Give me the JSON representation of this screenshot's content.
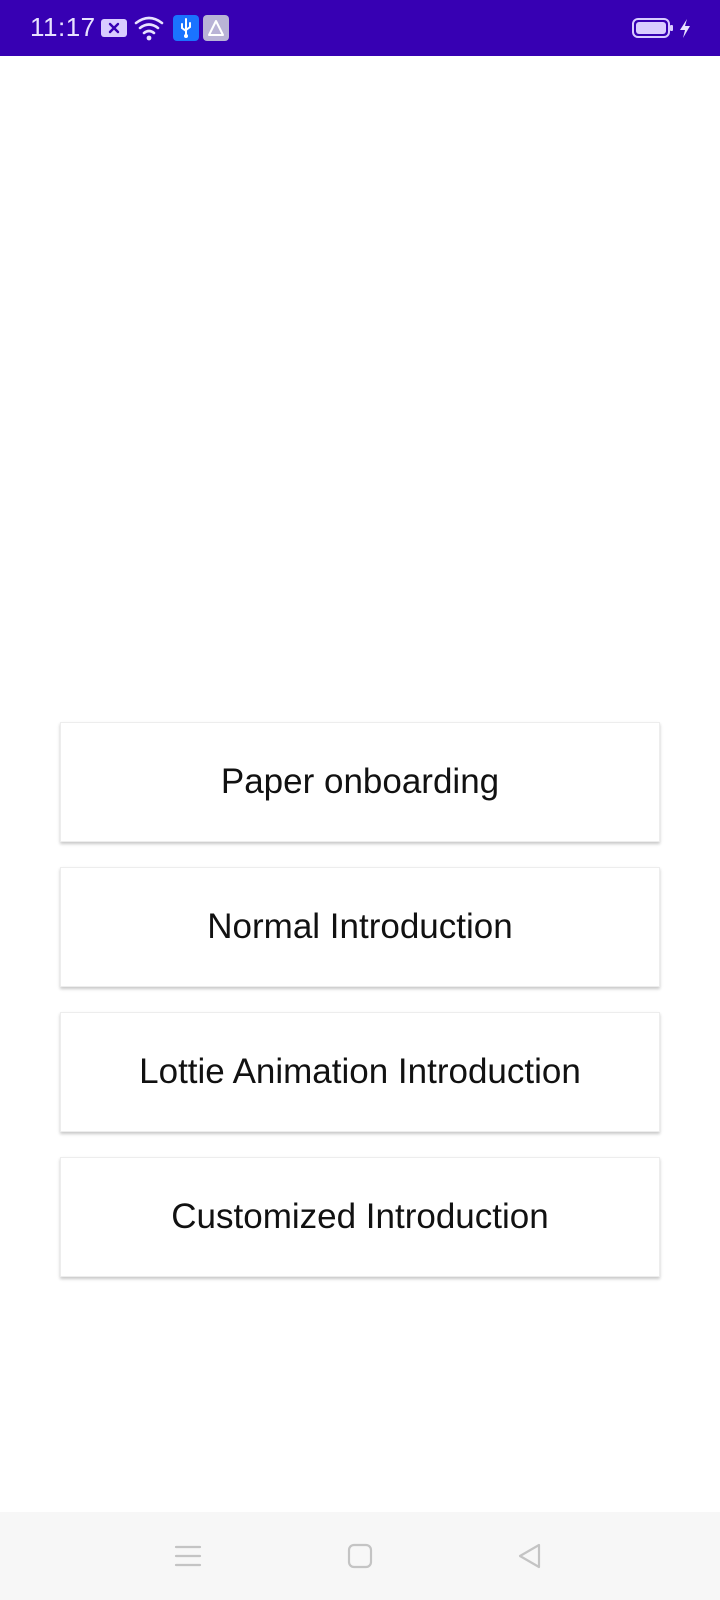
{
  "status_bar": {
    "time": "11:17",
    "background_color": "#3700b3",
    "icons": [
      "notification-icon",
      "wifi-icon",
      "usb-icon",
      "app-icon",
      "battery-icon",
      "charging-icon"
    ]
  },
  "buttons": [
    {
      "label": "Paper onboarding"
    },
    {
      "label": "Normal Introduction"
    },
    {
      "label": "Lottie Animation Introduction"
    },
    {
      "label": "Customized Introduction"
    }
  ],
  "nav_bar": {
    "icons": [
      "menu-icon",
      "home-icon",
      "back-icon"
    ]
  }
}
